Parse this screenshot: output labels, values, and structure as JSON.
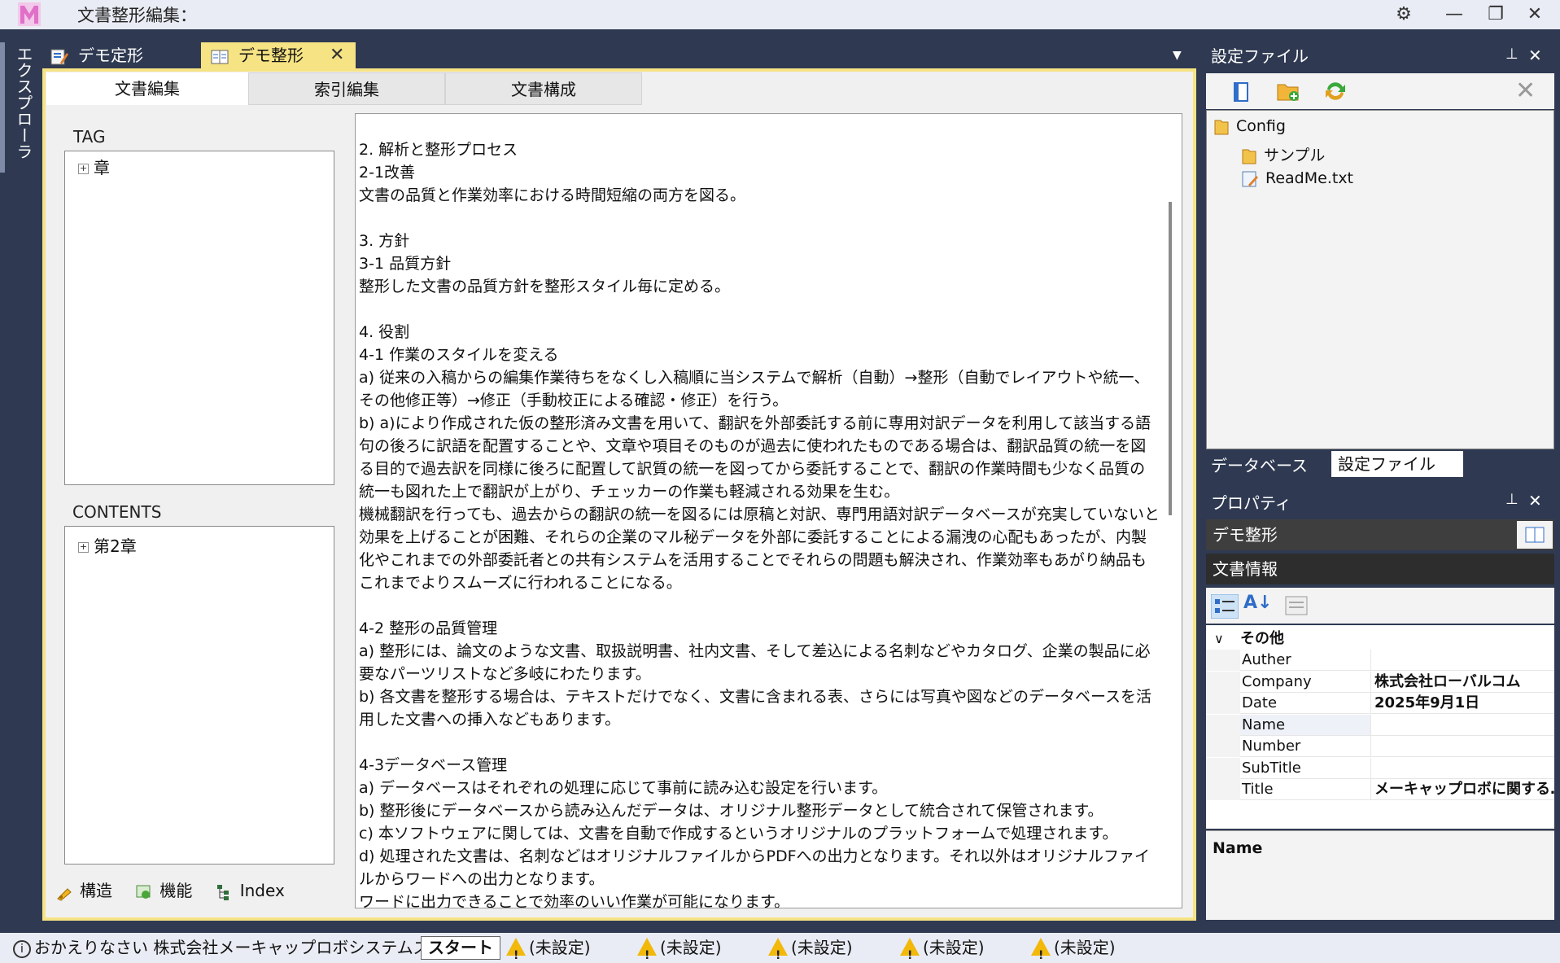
{
  "window": {
    "title": "文書整形編集：",
    "controls": [
      "⚙",
      "—",
      "❐",
      "✕"
    ]
  },
  "explorer": {
    "label": "エクスプローラ"
  },
  "doc_tabs": [
    {
      "label": "デモ定形"
    },
    {
      "label": "デモ整形",
      "active": true
    }
  ],
  "sub_tabs": [
    "文書編集",
    "索引編集",
    "文書構成"
  ],
  "tag_section": {
    "label": "TAG",
    "items": [
      {
        "label": "章"
      }
    ]
  },
  "contents_section": {
    "label": "CONTENTS",
    "items": [
      {
        "label": "第2章"
      }
    ]
  },
  "bottom_tabs": [
    "構造",
    "機能",
    "Index"
  ],
  "editor": {
    "lines": [
      "2. 解析と整形プロセス",
      "2-1改善",
      "文書の品質と作業効率における時間短縮の両方を図る。",
      "",
      "3. 方針",
      "3-1 品質方針",
      "整形した文書の品質方針を整形スタイル毎に定める。",
      "",
      "4. 役割",
      "4-1 作業のスタイルを変える",
      "a) 従来の入稿からの編集作業待ちをなくし入稿順に当システムで解析（自動）→整形（自動でレイアウトや統一、その他修正等）→修正（手動校正による確認・修正）を行う。",
      "b) a)により作成された仮の整形済み文書を用いて、翻訳を外部委託する前に専用対訳データを利用して該当する語句の後ろに訳語を配置することや、文章や項目そのものが過去に使われたものである場合は、翻訳品質の統一を図る目的で過去訳を同様に後ろに配置して訳質の統一を図ってから委託することで、翻訳の作業時間も少なく品質の統一も図れた上で翻訳が上がり、チェッカーの作業も軽減される効果を生む。",
      "機械翻訳を行っても、過去からの翻訳の統一を図るには原稿と対訳、専門用語対訳データベースが充実していないと効果を上げることが困難、それらの企業のマル秘データを外部に委託することによる漏洩の心配もあったが、内製化やこれまでの外部委託者との共有システムを活用することでそれらの問題も解決され、作業効率もあがり納品もこれまでよりスムーズに行われることになる。",
      "",
      "4-2 整形の品質管理",
      "a) 整形には、論文のような文書、取扱説明書、社内文書、そして差込による名刺などやカタログ、企業の製品に必要なパーツリストなど多岐にわたります。",
      "b) 各文書を整形する場合は、テキストだけでなく、文書に含まれる表、さらには写真や図などのデータベースを活用した文書への挿入などもあります。",
      "",
      "4-3データベース管理",
      "a) データベースはそれぞれの処理に応じて事前に読み込む設定を行います。",
      "b) 整形後にデータベースから読み込んだデータは、オリジナル整形データとして統合されて保管されます。",
      "c) 本ソフトウェアに関しては、文書を自動で作成するというオリジナルのプラットフォームで処理されます。",
      "d) 処理された文書は、名刺などはオリジナルファイルからPDFへの出力となります。それ以外はオリジナルファイルからワードへの出力となります。",
      "ワードに出力できることで効率のいい作業が可能になります。"
    ]
  },
  "settings_panel": {
    "title": "設定ファイル",
    "tree": [
      {
        "label": "Config",
        "icon": "folder-icon",
        "level": 0
      },
      {
        "label": "サンプル",
        "icon": "folder-icon",
        "level": 1
      },
      {
        "label": "ReadMe.txt",
        "icon": "text-file-icon",
        "level": 1
      }
    ],
    "tabs": [
      "データベース",
      "設定ファイル"
    ]
  },
  "properties_panel": {
    "title": "プロパティ",
    "object": "デモ整形",
    "section": "文書情報",
    "category": "その他",
    "rows": [
      {
        "name": "Auther",
        "value": ""
      },
      {
        "name": "Company",
        "value": "株式会社ローバルコム"
      },
      {
        "name": "Date",
        "value": "2025年9月1日"
      },
      {
        "name": "Name",
        "value": ""
      },
      {
        "name": "Number",
        "value": ""
      },
      {
        "name": "SubTitle",
        "value": ""
      },
      {
        "name": "Title",
        "value": "メーキャップロボに関する…"
      }
    ],
    "description_title": "Name"
  },
  "status_bar": {
    "message": "おかえりなさい 株式会社メーキャップロボシステムズさん",
    "start_label": "スタート",
    "slots": [
      "(未設定)",
      "(未設定)",
      "(未設定)",
      "(未設定)",
      "(未設定)"
    ]
  },
  "colors": {
    "frame": "#2f3a52",
    "active_tab": "#f6e384",
    "warning": "#f2b80a"
  }
}
